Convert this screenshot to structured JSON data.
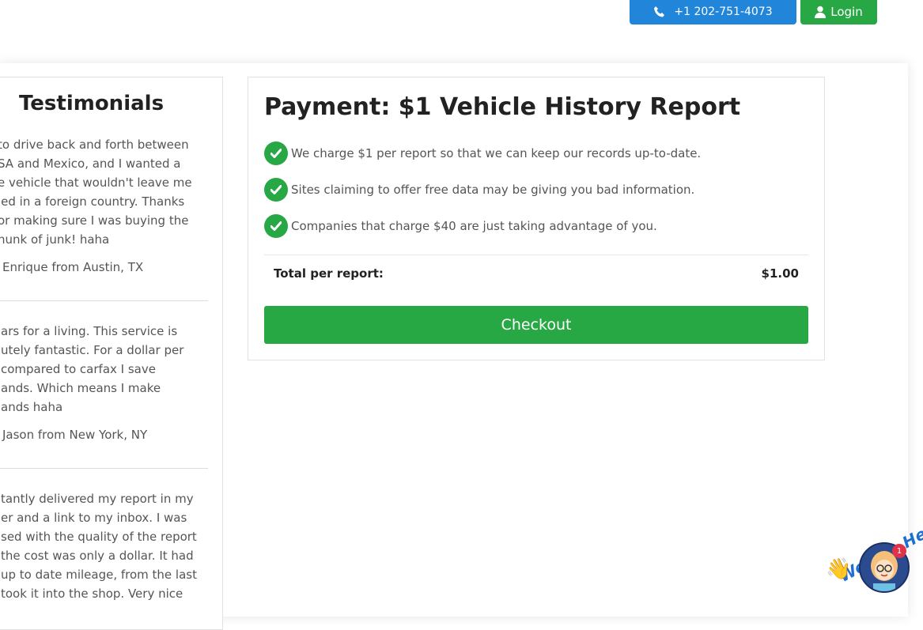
{
  "header": {
    "phone_label": "+1 202-751-4073",
    "login_label": "Login"
  },
  "testimonials": {
    "title": "Testimonials",
    "items": [
      {
        "quote": "to drive back and forth between\nSA and Mexico, and I wanted a\ne vehicle that wouldn't leave me\nled in a foreign country. Thanks\nor making sure I was buying the\nhunk of junk! haha",
        "author": "Enrique from Austin, TX"
      },
      {
        "quote": "ars for a living. This service is\nutely fantastic. For a dollar per\ncompared to carfax I save\nands. Which means I make\nands haha",
        "author": "Jason from New York, NY"
      },
      {
        "quote": "tantly delivered my report in my\ner and a link to my inbox. I was\nsed with the quality of the report\nthe cost was only a dollar. It had\nup to date mileage, from the last\ntook it into the shop. Very nice",
        "author": ""
      }
    ]
  },
  "payment": {
    "title": "Payment: $1 Vehicle History Report",
    "bullets": [
      "We charge $1 per report so that we can keep our records up-to-date.",
      "Sites claiming to offer free data may be giving you bad information.",
      "Companies that charge $40 are just taking advantage of you."
    ],
    "total_label": "Total per report:",
    "total_value": "$1.00",
    "checkout_label": "Checkout"
  },
  "chat": {
    "text": "We Are Here!",
    "badge_count": "1"
  },
  "colors": {
    "primary_blue": "#2185d9",
    "success_green": "#28a745"
  }
}
